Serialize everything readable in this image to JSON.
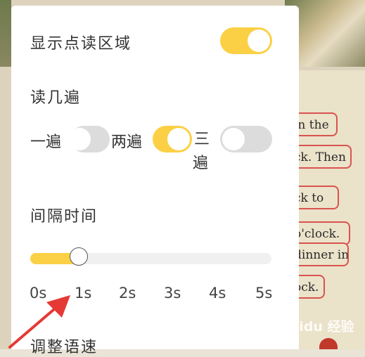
{
  "panel": {
    "show_area_label": "显示点读区域",
    "show_area_on": true,
    "repeat_label": "读几遍",
    "repeat_options": [
      {
        "label": "一遍",
        "on": false
      },
      {
        "label": "两遍",
        "on": true
      },
      {
        "label": "三",
        "label2": "遍",
        "on": false
      }
    ],
    "interval_label": "间隔时间",
    "interval_value_fraction": 0.2,
    "interval_ticks": [
      "0s",
      "1s",
      "2s",
      "3s",
      "4s",
      "5s"
    ],
    "speed_label": "调整语速"
  },
  "background": {
    "bubbles": [
      "in the",
      "ck. Then",
      "ck to",
      "o'clock.",
      "dinner in",
      "ock."
    ],
    "watermark": "Baidu 经验"
  },
  "colors": {
    "accent": "#fbd044",
    "toggle_off": "#dcdcdc",
    "arrow": "#e53935"
  }
}
